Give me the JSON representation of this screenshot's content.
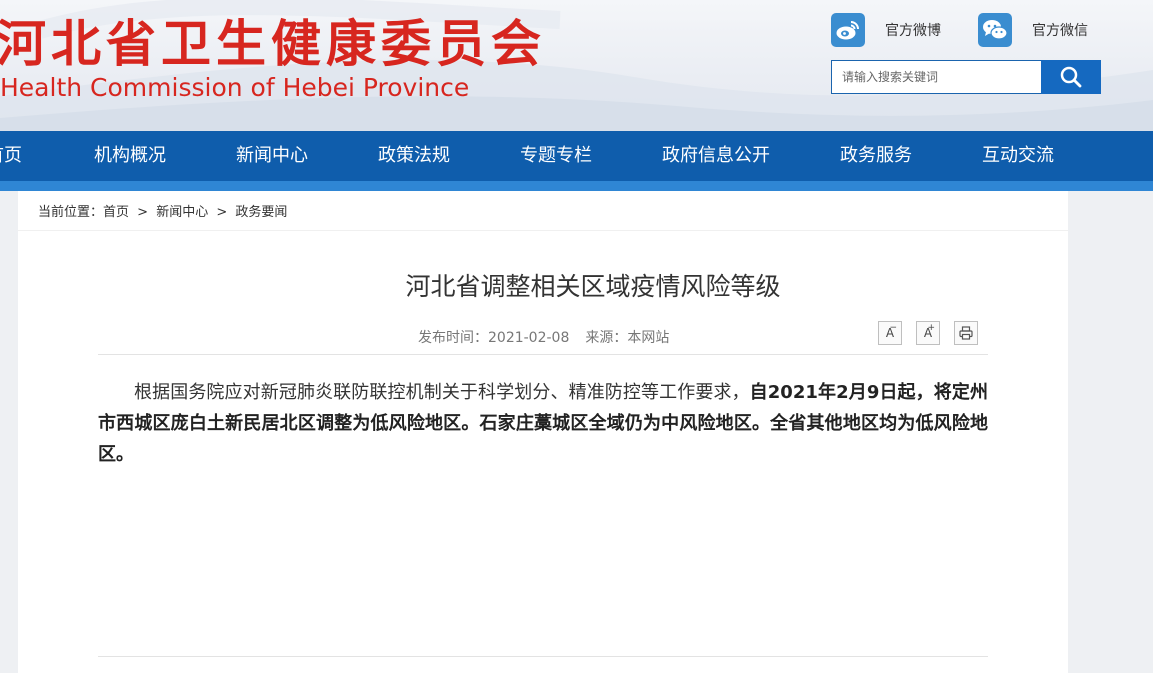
{
  "header": {
    "title": "河北省卫生健康委员会",
    "subtitle": "Health Commission of Hebei Province",
    "weibo_label": "官方微博",
    "wechat_label": "官方微信",
    "search_placeholder": "请输入搜索关键词",
    "accent_red": "#d7261f"
  },
  "nav": {
    "items": [
      "首页",
      "机构概况",
      "新闻中心",
      "政策法规",
      "专题专栏",
      "政府信息公开",
      "政务服务",
      "互动交流"
    ],
    "background": "#0f5dac"
  },
  "breadcrumb": {
    "prefix": "当前位置：",
    "items": [
      "首页",
      "新闻中心",
      "政务要闻"
    ],
    "separator": ">"
  },
  "article": {
    "title": "河北省调整相关区域疫情风险等级",
    "publish_time": "发布时间：2021-02-08",
    "source": "来源：本网站",
    "font_decrease": "A",
    "font_increase": "A",
    "body_plain": "根据国务院应对新冠肺炎联防联控机制关于科学划分、精准防控等工作要求，",
    "body_bold": "自2021年2月9日起，将定州市西城区庞白土新民居北区调整为低风险地区。石家庄藁城区全域仍为中风险地区。全省其他地区均为低风险地区。"
  },
  "icons": {
    "weibo": "weibo-icon",
    "wechat": "wechat-icon",
    "search": "search-icon",
    "print": "print-icon"
  }
}
